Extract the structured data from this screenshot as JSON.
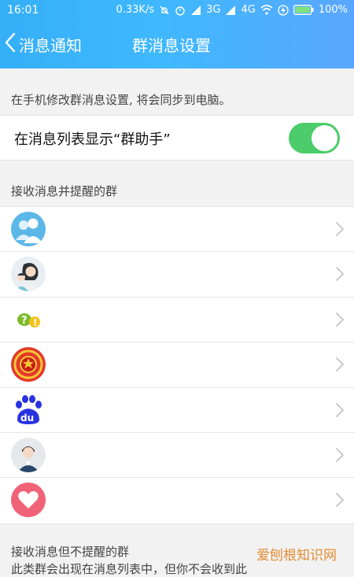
{
  "status_bar": {
    "time": "16:01",
    "speed": "0.33K/s",
    "network": "3G",
    "network2": "4G",
    "battery": "100%"
  },
  "nav": {
    "back_label": "消息通知",
    "title": "群消息设置"
  },
  "hint_text": "在手机修改群消息设置, 将会同步到电脑。",
  "switch_row": {
    "label": "在消息列表显示“群助手”",
    "enabled": true
  },
  "sections": {
    "notify": {
      "header": "接收消息并提醒的群"
    },
    "silent": {
      "header": "接收消息但不提醒的群",
      "sub": "此类群会出现在消息列表中，但你不会收到此"
    }
  },
  "groups": [
    {
      "avatar": "group-people-icon"
    },
    {
      "avatar": "woman-man-icon"
    },
    {
      "avatar": "question-bubbles-icon"
    },
    {
      "avatar": "emblem-icon"
    },
    {
      "avatar": "baidu-paw-icon"
    },
    {
      "avatar": "man-suit-icon"
    },
    {
      "avatar": "heart-icon"
    }
  ],
  "watermark": "爱刨根知识网",
  "colors": {
    "header_start": "#35aff7",
    "header_end": "#5aa7ff",
    "toggle_on": "#4ccc6a",
    "background": "#f2f2f2"
  }
}
